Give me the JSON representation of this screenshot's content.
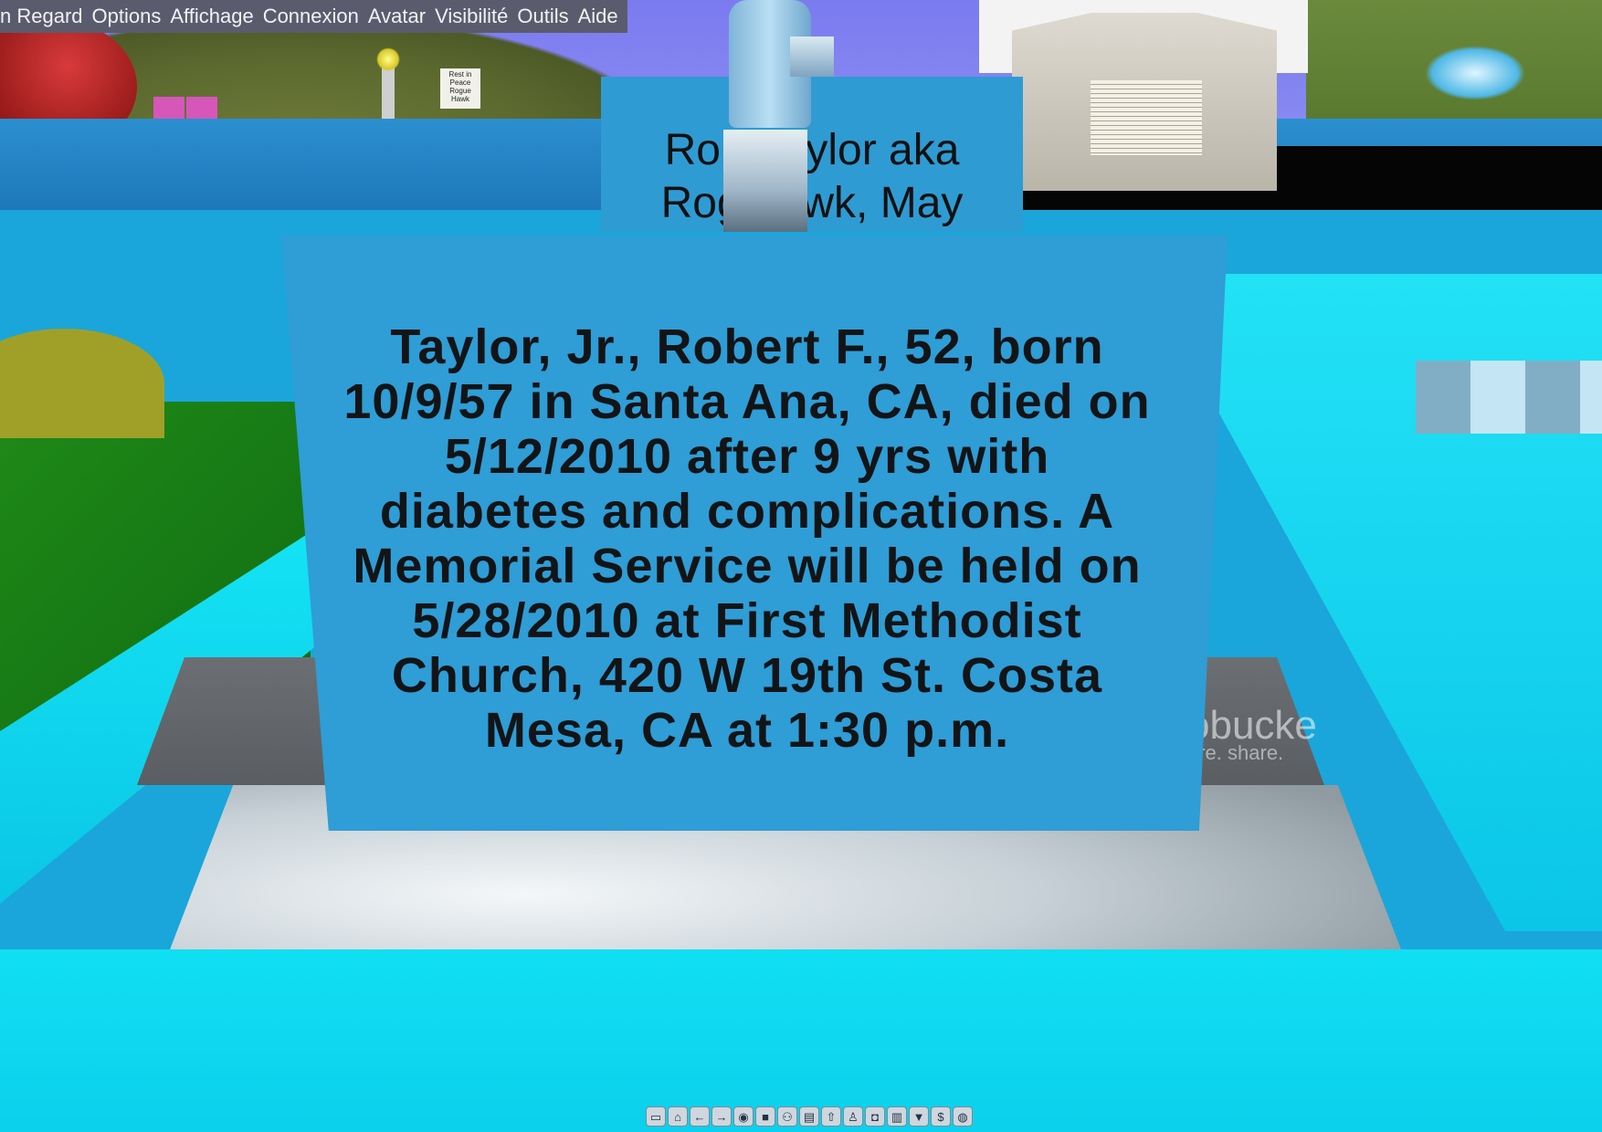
{
  "menu": [
    {
      "label": "n Regard"
    },
    {
      "label": "Options"
    },
    {
      "label": "Affichage"
    },
    {
      "label": "Connexion"
    },
    {
      "label": "Avatar"
    },
    {
      "label": "Visibilité"
    },
    {
      "label": "Outils"
    },
    {
      "label": "Aide"
    }
  ],
  "scene": {
    "upper_sign_lines": [
      "Robe   aylor aka",
      "Rogu   awk, May"
    ],
    "main_sign_lines": [
      "Taylor, Jr., Robert F., 52, born",
      "10/9/57 in Santa Ana, CA, died on",
      "5/12/2010 after 9 yrs with",
      "diabetes and complications. A",
      "Memorial Service will be held on",
      "5/28/2010 at First Methodist",
      "Church, 420 W 19th St. Costa",
      "Mesa, CA at 1:30 p.m."
    ],
    "far_sign_lines": [
      "Rest in",
      "Peace",
      "Rogue",
      "Hawk"
    ],
    "watermark": "obucke",
    "watermark_sub": "ore. share."
  },
  "toolbar": [
    {
      "icon": "folder-icon",
      "glyph": "▭"
    },
    {
      "icon": "home-icon",
      "glyph": "⌂"
    },
    {
      "icon": "back-icon",
      "glyph": "←"
    },
    {
      "icon": "forward-icon",
      "glyph": "→"
    },
    {
      "icon": "eye-icon",
      "glyph": "◉"
    },
    {
      "icon": "camera-icon",
      "glyph": "■"
    },
    {
      "icon": "people-icon",
      "glyph": "⚇"
    },
    {
      "icon": "chat-icon",
      "glyph": "▤"
    },
    {
      "icon": "up-icon",
      "glyph": "⇧"
    },
    {
      "icon": "walk-icon",
      "glyph": "♙"
    },
    {
      "icon": "snapshot-icon",
      "glyph": "◘"
    },
    {
      "icon": "map-icon",
      "glyph": "▥"
    },
    {
      "icon": "shirt-icon",
      "glyph": "▼"
    },
    {
      "icon": "money-icon",
      "glyph": "$"
    },
    {
      "icon": "globe-icon",
      "glyph": "◍"
    }
  ],
  "colors": {
    "sign": "#2f9dd6",
    "menubar": "#5a5c6e",
    "cyan": "#10dff2"
  }
}
